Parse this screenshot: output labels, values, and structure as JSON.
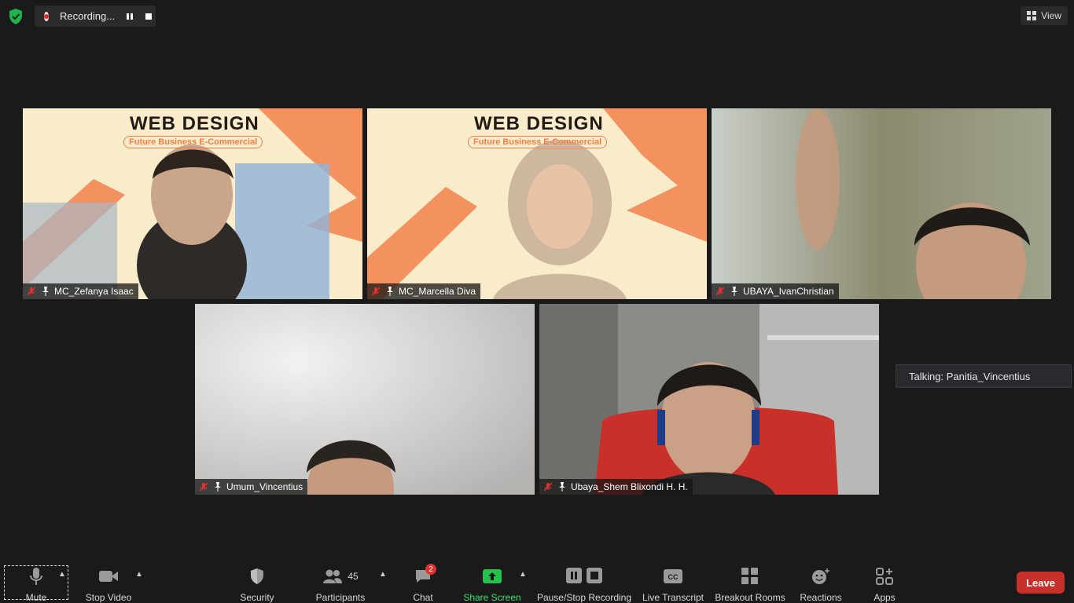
{
  "recording": {
    "label": "Recording..."
  },
  "view": {
    "label": "View"
  },
  "participants_tiles": [
    {
      "name": "MC_Zefanya Isaac"
    },
    {
      "name": "MC_Marcella Diva"
    },
    {
      "name": "UBAYA_IvanChristian"
    },
    {
      "name": "Umum_Vincentius"
    },
    {
      "name": "Ubaya_Shem Blixondi H. H."
    }
  ],
  "banner": {
    "title": "WEB DESIGN",
    "subtitle": "Future Business E-Commercial"
  },
  "talking": {
    "label": "Talking: Panitia_Vincentius"
  },
  "toolbar": {
    "mute": "Mute",
    "stop_video": "Stop Video",
    "security": "Security",
    "participants": "Participants",
    "participants_count": "45",
    "chat": "Chat",
    "chat_badge": "2",
    "share_screen": "Share Screen",
    "pause_stop": "Pause/Stop Recording",
    "live_transcript": "Live Transcript",
    "breakout": "Breakout Rooms",
    "reactions": "Reactions",
    "apps": "Apps",
    "leave": "Leave"
  },
  "colors": {
    "share_green": "#24c24c",
    "leave_red": "#c8302a",
    "badge_red": "#e0322c",
    "banner_orange": "#f2845a"
  }
}
